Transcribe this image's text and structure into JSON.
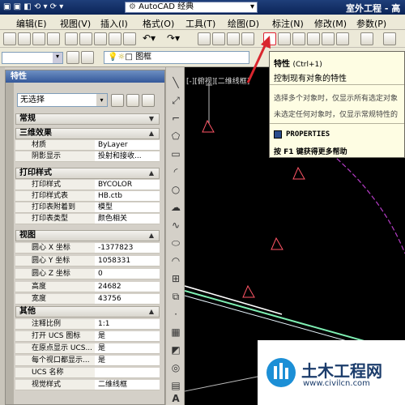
{
  "window": {
    "app_dropdown": "AutoCAD 经典",
    "title_right": "室外工程 - 高"
  },
  "menu": [
    "编辑(E)",
    "视图(V)",
    "插入(I)",
    "格式(O)",
    "工具(T)",
    "绘图(D)",
    "标注(N)",
    "修改(M)",
    "参数(P)"
  ],
  "layer": {
    "name": "图框"
  },
  "palette": {
    "title": "特性",
    "selection": "无选择",
    "sections": [
      {
        "name": "常规",
        "rows": []
      },
      {
        "name": "三维效果",
        "rows": [
          {
            "k": "材质",
            "v": "ByLayer"
          },
          {
            "k": "阴影显示",
            "v": "投射和接收..."
          }
        ]
      },
      {
        "name": "打印样式",
        "rows": [
          {
            "k": "打印样式",
            "v": "BYCOLOR"
          },
          {
            "k": "打印样式表",
            "v": "HB.ctb"
          },
          {
            "k": "打印表附着到",
            "v": "模型"
          },
          {
            "k": "打印表类型",
            "v": "颜色相关"
          }
        ]
      },
      {
        "name": "视图",
        "rows": [
          {
            "k": "圆心 X 坐标",
            "v": "-1377823"
          },
          {
            "k": "圆心 Y 坐标",
            "v": "1058331"
          },
          {
            "k": "圆心 Z 坐标",
            "v": "0"
          },
          {
            "k": "高度",
            "v": "24682"
          },
          {
            "k": "宽度",
            "v": "43756"
          }
        ]
      },
      {
        "name": "其他",
        "rows": [
          {
            "k": "注释比例",
            "v": "1:1"
          },
          {
            "k": "打开 UCS 图标",
            "v": "是"
          },
          {
            "k": "在原点显示 UCS...",
            "v": "是"
          },
          {
            "k": "每个视口都显示...",
            "v": "是"
          },
          {
            "k": "UCS 名称",
            "v": ""
          },
          {
            "k": "视觉样式",
            "v": "二维线框"
          }
        ]
      }
    ]
  },
  "viewport": {
    "label": "[-][俯视][二维线框]"
  },
  "tooltip": {
    "title": "特性",
    "shortcut": "(Ctrl+1)",
    "desc": "控制现有对象的特性",
    "line1": "选择多个对象时，仅显示所有选定对象",
    "line2": "未选定任何对象时，仅显示常规特性的",
    "command": "PROPERTIES",
    "help": "按 F1 键获得更多帮助"
  },
  "watermark": {
    "brand": "土木工程网",
    "url": "www.civilcn.com"
  },
  "colors": {
    "highlight_red": "#d9262e",
    "canvas_bg": "#000000"
  }
}
